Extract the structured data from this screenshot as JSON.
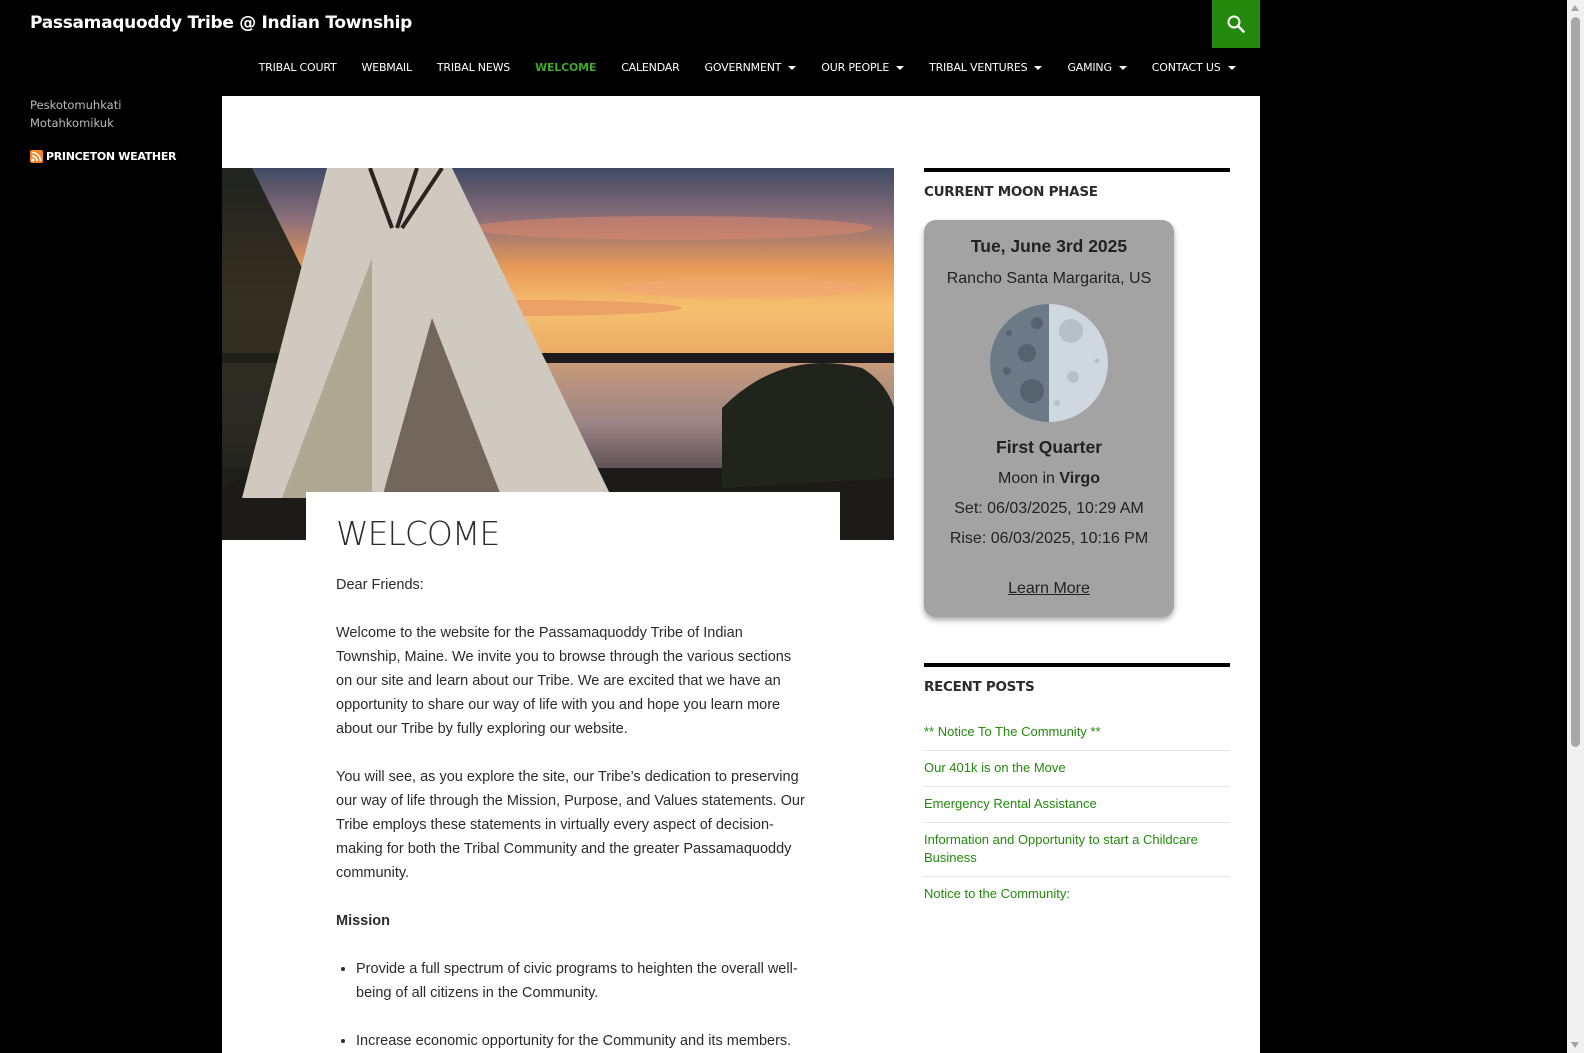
{
  "header": {
    "site_title": "Passamaquoddy Tribe @ Indian Township",
    "search_icon": "search-icon",
    "nav": [
      {
        "label": "TRIBAL COURT",
        "has_dropdown": false,
        "active": false
      },
      {
        "label": "WEBMAIL",
        "has_dropdown": false,
        "active": false
      },
      {
        "label": "TRIBAL NEWS",
        "has_dropdown": false,
        "active": false
      },
      {
        "label": "WELCOME",
        "has_dropdown": false,
        "active": true
      },
      {
        "label": "CALENDAR",
        "has_dropdown": false,
        "active": false
      },
      {
        "label": "GOVERNMENT",
        "has_dropdown": true,
        "active": false
      },
      {
        "label": "OUR PEOPLE",
        "has_dropdown": true,
        "active": false
      },
      {
        "label": "TRIBAL VENTURES",
        "has_dropdown": true,
        "active": false
      },
      {
        "label": "GAMING",
        "has_dropdown": true,
        "active": false
      },
      {
        "label": "CONTACT US",
        "has_dropdown": true,
        "active": false
      }
    ]
  },
  "left_sidebar": {
    "tagline_line1": "Peskotomuhkati",
    "tagline_line2": "Motahkomikuk",
    "weather_link": "PRINCETON WEATHER",
    "rss_icon": "rss-icon"
  },
  "entry": {
    "title": "WELCOME",
    "greeting": "Dear Friends:",
    "para1": "Welcome to the website for the Passamaquoddy Tribe of Indian Township, Maine. We invite you to browse through the various sec­tions on our site and learn about our Tribe. We are excited that we have an opportunity to share our way of life with you and hope you learn more about our Tribe by fully exploring our website.",
    "para2": "You will see, as you explore the site, our Tribe’s dedication to pre­serving our way of life through the Mission, Purpose, and Values statements. Our Tribe employs these statements in virtually every aspect of decision-making for both the Tribal Community and the greater Passamaquoddy community.",
    "mission_heading": "Mission",
    "mission_items": [
      "Provide a full spectrum of civic programs to heighten the overall well-being of all citizens in the Community.",
      "Increase economic opportunity for the Community and its mem­bers."
    ]
  },
  "moon_widget": {
    "title": "CURRENT MOON PHASE",
    "date": "Tue, June 3rd 2025",
    "location": "Rancho Santa Margarita, US",
    "phase": "First Quarter",
    "moon_in_prefix": "Moon in ",
    "moon_in_sign": "Virgo",
    "set": "Set: 06/03/2025, 10:29 AM",
    "rise": "Rise: 06/03/2025, 10:16 PM",
    "learn_more": "Learn More",
    "moon_icon": "moon-icon"
  },
  "recent_posts": {
    "title": "RECENT POSTS",
    "items": [
      "** Notice To The Community **",
      "Our 401k is on the Move",
      "Emergency Rental Assistance",
      "Information and Opportunity to start a Childcare Business",
      "Notice to the Community:"
    ]
  },
  "colors": {
    "accent_green": "#24890d",
    "active_nav_green": "#41a62a",
    "moon_card_bg": "#a3a3a3"
  }
}
